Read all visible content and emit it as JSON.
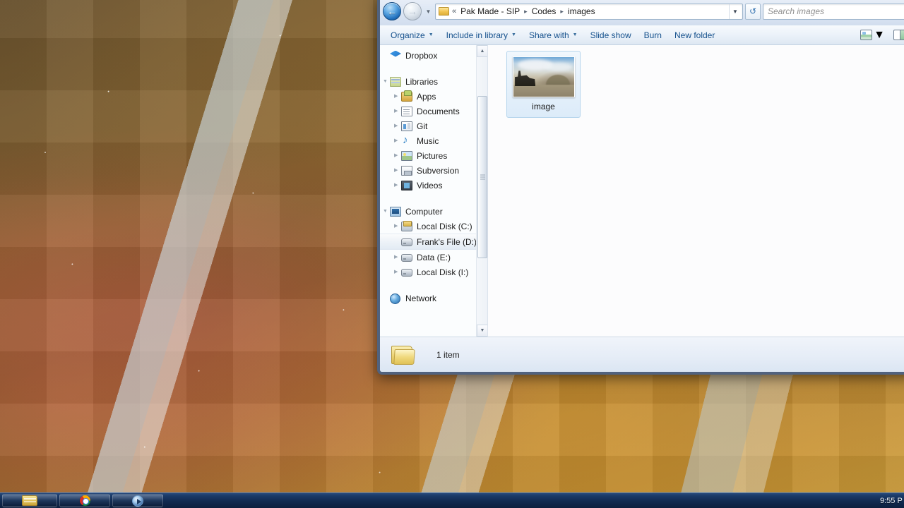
{
  "desktop": {
    "taskbar": {
      "buttons": [
        {
          "name": "explorer",
          "icon": "folder-icon",
          "label": ""
        },
        {
          "name": "chrome",
          "icon": "chrome-icon",
          "label": ""
        },
        {
          "name": "media-player",
          "icon": "media-player-icon",
          "label": ""
        }
      ],
      "clock": "9:55 P"
    }
  },
  "window": {
    "navigation": {
      "back_icon": "back-arrow-icon",
      "forward_icon": "forward-arrow-icon",
      "history_icon": "chevron-down-icon",
      "refresh_icon": "refresh-icon",
      "address_dropdown_icon": "chevron-down-icon"
    },
    "address": {
      "folder_icon": "folder-icon",
      "overflow": "«",
      "crumbs": [
        "Pak Made - SIP",
        "Codes",
        "images"
      ],
      "separator": "▸"
    },
    "search": {
      "placeholder": "Search images",
      "value": ""
    },
    "toolbar": {
      "items": [
        {
          "label": "Organize",
          "has_caret": true
        },
        {
          "label": "Include in library",
          "has_caret": true
        },
        {
          "label": "Share with",
          "has_caret": true
        },
        {
          "label": "Slide show",
          "has_caret": false
        },
        {
          "label": "Burn",
          "has_caret": false
        },
        {
          "label": "New folder",
          "has_caret": false
        }
      ],
      "view_icon": "view-mode-icon",
      "view_caret_icon": "chevron-down-icon",
      "preview_pane_icon": "preview-pane-icon"
    },
    "sidebar": {
      "items": [
        {
          "label": "Dropbox",
          "icon": "dropbox-icon",
          "level": 0,
          "state": "normal"
        },
        {
          "label": "Libraries",
          "icon": "libraries-icon",
          "level": 0,
          "state": "normal"
        },
        {
          "label": "Apps",
          "icon": "apps-library-icon",
          "level": 1,
          "state": "normal"
        },
        {
          "label": "Documents",
          "icon": "documents-library-icon",
          "level": 1,
          "state": "normal"
        },
        {
          "label": "Git",
          "icon": "git-library-icon",
          "level": 1,
          "state": "normal"
        },
        {
          "label": "Music",
          "icon": "music-library-icon",
          "level": 1,
          "state": "normal"
        },
        {
          "label": "Pictures",
          "icon": "pictures-library-icon",
          "level": 1,
          "state": "normal"
        },
        {
          "label": "Subversion",
          "icon": "subversion-library-icon",
          "level": 1,
          "state": "normal"
        },
        {
          "label": "Videos",
          "icon": "videos-library-icon",
          "level": 1,
          "state": "normal"
        },
        {
          "label": "Computer",
          "icon": "computer-icon",
          "level": 0,
          "state": "normal"
        },
        {
          "label": "Local Disk (C:)",
          "icon": "system-drive-icon",
          "level": 1,
          "state": "normal"
        },
        {
          "label": "Frank's File (D:)",
          "icon": "drive-icon",
          "level": 1,
          "state": "hovered"
        },
        {
          "label": "Data (E:)",
          "icon": "drive-icon",
          "level": 1,
          "state": "normal"
        },
        {
          "label": "Local Disk (I:)",
          "icon": "drive-icon",
          "level": 1,
          "state": "normal"
        },
        {
          "label": "Network",
          "icon": "network-icon",
          "level": 0,
          "state": "normal"
        }
      ],
      "scrollbar": {
        "up_icon": "scroll-up-icon",
        "down_icon": "scroll-down-icon"
      }
    },
    "files": [
      {
        "label": "image",
        "type": "image-thumbnail",
        "selected": true
      }
    ],
    "statusbar": {
      "folder_icon": "folder-icon",
      "item_count": "1 item"
    }
  }
}
